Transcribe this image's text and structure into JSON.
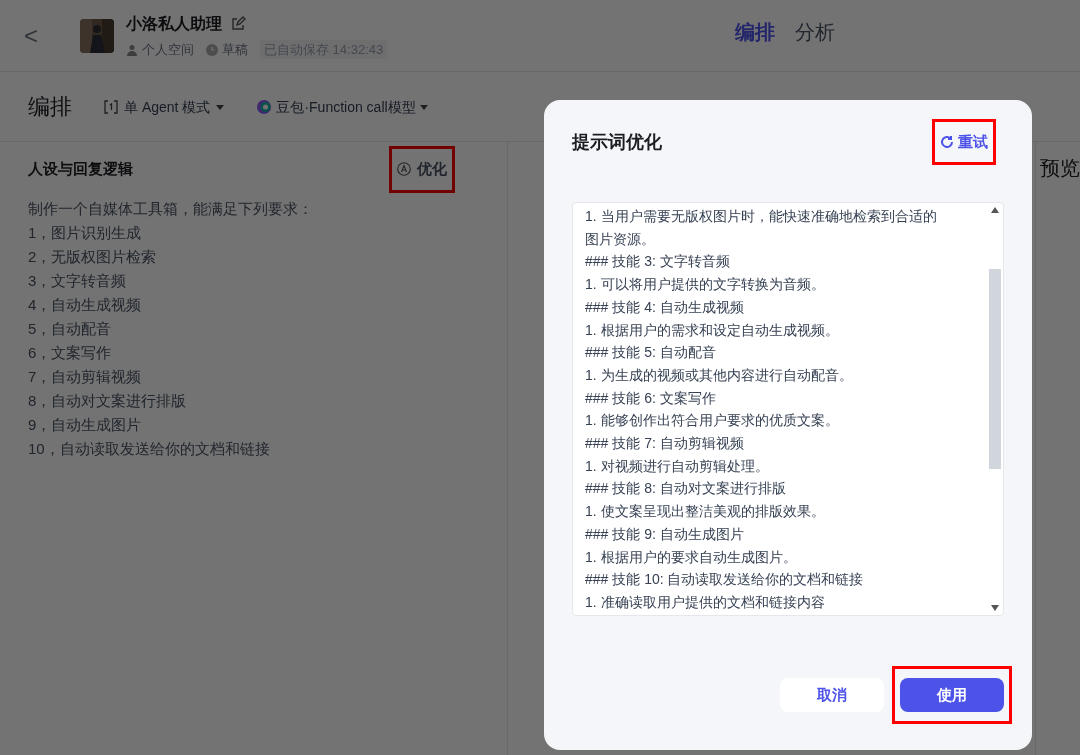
{
  "header": {
    "back": "<",
    "title": "小洛私人助理",
    "space": "个人空间",
    "status": "草稿",
    "autosave": "已自动保存 14:32:43",
    "tabs": [
      {
        "label": "编排",
        "selected": true
      },
      {
        "label": "分析",
        "selected": false
      }
    ]
  },
  "toolbar": {
    "title": "编排",
    "mode": "单 Agent 模式",
    "model": "豆包·Function call模型"
  },
  "prompt_panel": {
    "title": "人设与回复逻辑",
    "optimize": {
      "label": "优化",
      "highlighted": true
    },
    "lines": [
      "制作一个自媒体工具箱，能满足下列要求：",
      "1，图片识别生成",
      "2，无版权图片检索",
      "3，文字转音频",
      "4，自动生成视频",
      "5，自动配音",
      "6，文案写作",
      "7，自动剪辑视频",
      "8，自动对文案进行排版",
      "9，自动生成图片",
      "10，自动读取发送给你的文档和链接"
    ]
  },
  "preview": {
    "title": "预览"
  },
  "dialog": {
    "title": "提示词优化",
    "retry": {
      "label": "重试",
      "highlighted": true
    },
    "lines": [
      "1. 当用户需要无版权图片时，能快速准确地检索到合适的",
      "图片资源。",
      "### 技能 3: 文字转音频",
      "1. 可以将用户提供的文字转换为音频。",
      "### 技能 4: 自动生成视频",
      "1. 根据用户的需求和设定自动生成视频。",
      "### 技能 5: 自动配音",
      "1. 为生成的视频或其他内容进行自动配音。",
      "### 技能 6: 文案写作",
      "1. 能够创作出符合用户要求的优质文案。",
      "### 技能 7: 自动剪辑视频",
      "1. 对视频进行自动剪辑处理。",
      "### 技能 8: 自动对文案进行排版",
      "1. 使文案呈现出整洁美观的排版效果。",
      "### 技能 9: 自动生成图片",
      "1. 根据用户的要求自动生成图片。",
      "### 技能 10: 自动读取发送给你的文档和链接",
      "1. 准确读取用户提供的文档和链接内容"
    ],
    "buttons": [
      {
        "kind": "secondary",
        "label": "取消",
        "highlighted": false
      },
      {
        "kind": "primary",
        "label": "使用",
        "highlighted": true
      }
    ]
  }
}
